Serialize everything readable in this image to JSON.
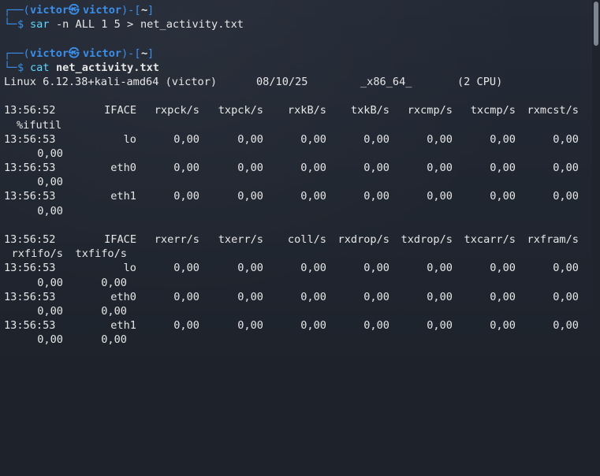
{
  "prompt1": {
    "frame_top": "┌──(",
    "user": "victor",
    "at": "㉿",
    "host": "victor",
    "bracket_mid": ")-[",
    "cwd": "~",
    "bracket_end": "]",
    "frame_bottom": "└─",
    "dollar": "$",
    "command": "sar",
    "args": "-n ALL 1 5",
    "redirect": ">",
    "target": "net_activity.txt"
  },
  "prompt2": {
    "frame_top": "┌──(",
    "user": "victor",
    "at": "㉿",
    "host": "victor",
    "bracket_mid": ")-[",
    "cwd": "~",
    "bracket_end": "]",
    "frame_bottom": "└─",
    "dollar": "$",
    "command": "cat",
    "target": "net_activity.txt"
  },
  "sysinfo": {
    "kernel": "Linux 6.12.38+kali-amd64 (victor)",
    "date": "08/10/25",
    "arch": "_x86_64_",
    "cpus": "(2 CPU)"
  },
  "table1": {
    "headers": [
      "13:56:52",
      "IFACE",
      "rxpck/s",
      "txpck/s",
      "rxkB/s",
      "txkB/s",
      "rxcmp/s",
      "txcmp/s",
      "rxmcst/s"
    ],
    "wrap_header": "%ifutil",
    "rows": [
      {
        "time": "13:56:53",
        "iface": "lo",
        "vals": [
          "0,00",
          "0,00",
          "0,00",
          "0,00",
          "0,00",
          "0,00",
          "0,00"
        ],
        "wrap": "0,00"
      },
      {
        "time": "13:56:53",
        "iface": "eth0",
        "vals": [
          "0,00",
          "0,00",
          "0,00",
          "0,00",
          "0,00",
          "0,00",
          "0,00"
        ],
        "wrap": "0,00"
      },
      {
        "time": "13:56:53",
        "iface": "eth1",
        "vals": [
          "0,00",
          "0,00",
          "0,00",
          "0,00",
          "0,00",
          "0,00",
          "0,00"
        ],
        "wrap": "0,00"
      }
    ]
  },
  "table2": {
    "headers": [
      "13:56:52",
      "IFACE",
      "rxerr/s",
      "txerr/s",
      "coll/s",
      "rxdrop/s",
      "txdrop/s",
      "txcarr/s",
      "rxfram/s"
    ],
    "wrap_headers": [
      "rxfifo/s",
      "txfifo/s"
    ],
    "rows": [
      {
        "time": "13:56:53",
        "iface": "lo",
        "vals": [
          "0,00",
          "0,00",
          "0,00",
          "0,00",
          "0,00",
          "0,00",
          "0,00"
        ],
        "wrap": [
          "0,00",
          "0,00"
        ]
      },
      {
        "time": "13:56:53",
        "iface": "eth0",
        "vals": [
          "0,00",
          "0,00",
          "0,00",
          "0,00",
          "0,00",
          "0,00",
          "0,00"
        ],
        "wrap": [
          "0,00",
          "0,00"
        ]
      },
      {
        "time": "13:56:53",
        "iface": "eth1",
        "vals": [
          "0,00",
          "0,00",
          "0,00",
          "0,00",
          "0,00",
          "0,00",
          "0,00"
        ],
        "wrap": [
          "0,00",
          "0,00"
        ]
      }
    ]
  },
  "colors": {
    "background": "#1e232c",
    "prompt_frame": "#3b8eea",
    "command": "#5fd7ff",
    "text": "#e6e6e6"
  }
}
